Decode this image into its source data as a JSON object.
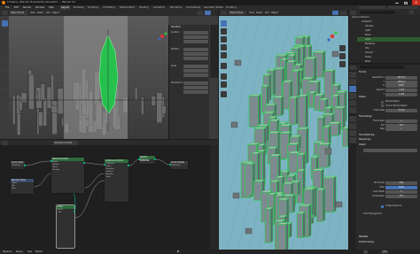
{
  "window": {
    "title": "C:\\Users\\...\\Blender Projects\\City Generator\\... - Blender 4.0",
    "controls": [
      "minimize-icon",
      "maximize-icon",
      "close-icon"
    ]
  },
  "menu": [
    "File",
    "Edit",
    "Render",
    "Window",
    "Help"
  ],
  "workspaces": [
    "Layout",
    "Modeling",
    "Sculpting",
    "UV Editing",
    "Texture Paint",
    "Shading",
    "Animation",
    "Rendering",
    "Compositing",
    "Geometry Nodes",
    "Scripting"
  ],
  "active_workspace": "Layout",
  "viewport_left": {
    "header_mode": "Object Mode",
    "menu": [
      "View",
      "Select",
      "Add",
      "Object"
    ],
    "sidebar_panel_title": "Transform",
    "sidebar_labels": [
      "Location",
      "Rotation",
      "Scale",
      "Dimensions"
    ]
  },
  "viewport_right": {
    "header_mode": "Object Mode",
    "menu": [
      "View",
      "Select",
      "Add",
      "Object"
    ],
    "shading": "solid"
  },
  "node_editor": {
    "header": "Geometry Nodes",
    "nodes": [
      {
        "title": "Group Input",
        "rows": [
          "Geometry"
        ]
      },
      {
        "title": "Distribute Points",
        "rows": [
          "Points",
          "Normal",
          "Mesh",
          "Density"
        ]
      },
      {
        "title": "Instance on Points",
        "rows": [
          "Instances",
          "Points",
          "Selection",
          "Instance",
          "Rotation",
          "Scale"
        ]
      },
      {
        "title": "Realize Instances",
        "rows": [
          "Geometry"
        ]
      },
      {
        "title": "Group Output",
        "rows": [
          "Geometry"
        ]
      },
      {
        "title": "Random Value",
        "rows": [
          "Value",
          "Min",
          "Max",
          "Seed"
        ]
      },
      {
        "title": "Cube",
        "rows": [
          "Mesh",
          "Size"
        ]
      }
    ]
  },
  "outliner": {
    "title": "Scene Collection",
    "items": [
      "Collection",
      "Camera",
      "Light",
      "Plane",
      "Cube",
      "Buildings",
      "City",
      "Ground",
      "Tower",
      "Road"
    ],
    "selected_index": 4
  },
  "properties": {
    "section_title": "Output",
    "format_label": "Format",
    "rows": [
      {
        "label": "Resolution X",
        "value": "1920 px"
      },
      {
        "label": "Y",
        "value": "1080 px"
      },
      {
        "label": "%",
        "value": "100%"
      },
      {
        "label": "Aspect X",
        "value": "1.000"
      },
      {
        "label": "Y",
        "value": "1.000"
      },
      {
        "label": "Render Region",
        "value": ""
      },
      {
        "label": "Crop to Render Region",
        "value": ""
      },
      {
        "label": "Frame Rate",
        "value": "24 fps"
      }
    ],
    "frame_range_title": "Frame Range",
    "frame_rows": [
      {
        "label": "Frame Start",
        "value": "1"
      },
      {
        "label": "End",
        "value": "250"
      },
      {
        "label": "Step",
        "value": "1"
      }
    ],
    "sections": [
      "Time Stretching",
      "Stereoscopy",
      "Output"
    ],
    "output_rows": [
      {
        "label": "File Format",
        "value": "PNG"
      },
      {
        "label": "Color",
        "value": "RGBA"
      },
      {
        "label": "Color Depth",
        "value": "8"
      },
      {
        "label": "Compression",
        "value": "15%"
      },
      {
        "label": "Image Sequence",
        "value": ""
      },
      {
        "label": "Color Management",
        "value": ""
      }
    ],
    "bottom_sections": [
      "Metadata",
      "Post Processing"
    ]
  },
  "timeline": {
    "labels": [
      "Playback",
      "Keying",
      "View",
      "Marker"
    ],
    "start": "1",
    "end": "250"
  },
  "colors": {
    "accent": "#4772b3",
    "selection_green": "#22d04a",
    "viewport_teal": "#7eb3c4",
    "node_green": "#2e6b3c"
  }
}
